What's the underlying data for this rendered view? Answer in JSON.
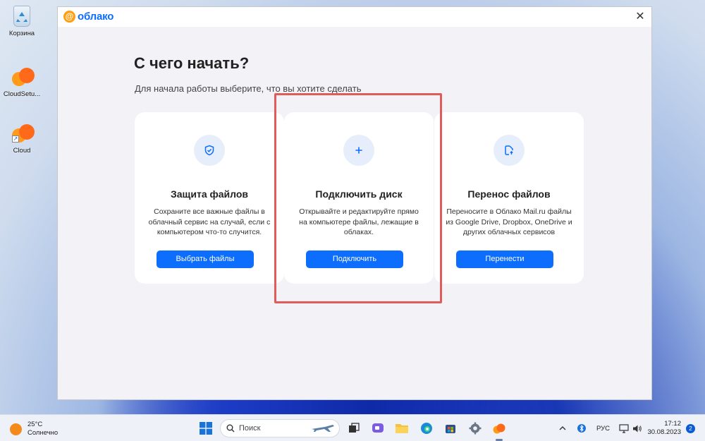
{
  "desktop": {
    "icons": [
      {
        "label": "Корзина"
      },
      {
        "label": "CloudSetu..."
      },
      {
        "label": "Cloud"
      }
    ]
  },
  "window": {
    "logo_text": "облако",
    "logo_symbol": "@",
    "close_symbol": "✕",
    "heading": "С чего начать?",
    "subheading": "Для начала работы выберите, что вы хотите сделать",
    "cards": [
      {
        "icon": "shield-icon",
        "title": "Защита файлов",
        "description": "Сохраните все важные файлы в облачный сервис на случай, если с компьютером что-то случится.",
        "button": "Выбрать файлы"
      },
      {
        "icon": "plus-icon",
        "title": "Подключить диск",
        "description": "Открывайте и редактируйте прямо на компьютере файлы, лежащие в облаках.",
        "button": "Подключить"
      },
      {
        "icon": "file-transfer-icon",
        "title": "Перенос файлов",
        "description": "Переносите в Облако Mail.ru файлы из Google Drive, Dropbox, OneDrive и других облачных сервисов",
        "button": "Перенести"
      }
    ],
    "highlighted_card_index": 1
  },
  "taskbar": {
    "weather_temp": "25°C",
    "weather_desc": "Солнечно",
    "search_placeholder": "Поиск",
    "language": "РУС",
    "time": "17:12",
    "date": "30.08.2023",
    "notification_count": "2"
  },
  "colors": {
    "accent": "#0d6efd",
    "logo_orange": "#ff9e0f",
    "highlight_red": "#e25b5b",
    "window_bg": "#f3f2f6"
  }
}
